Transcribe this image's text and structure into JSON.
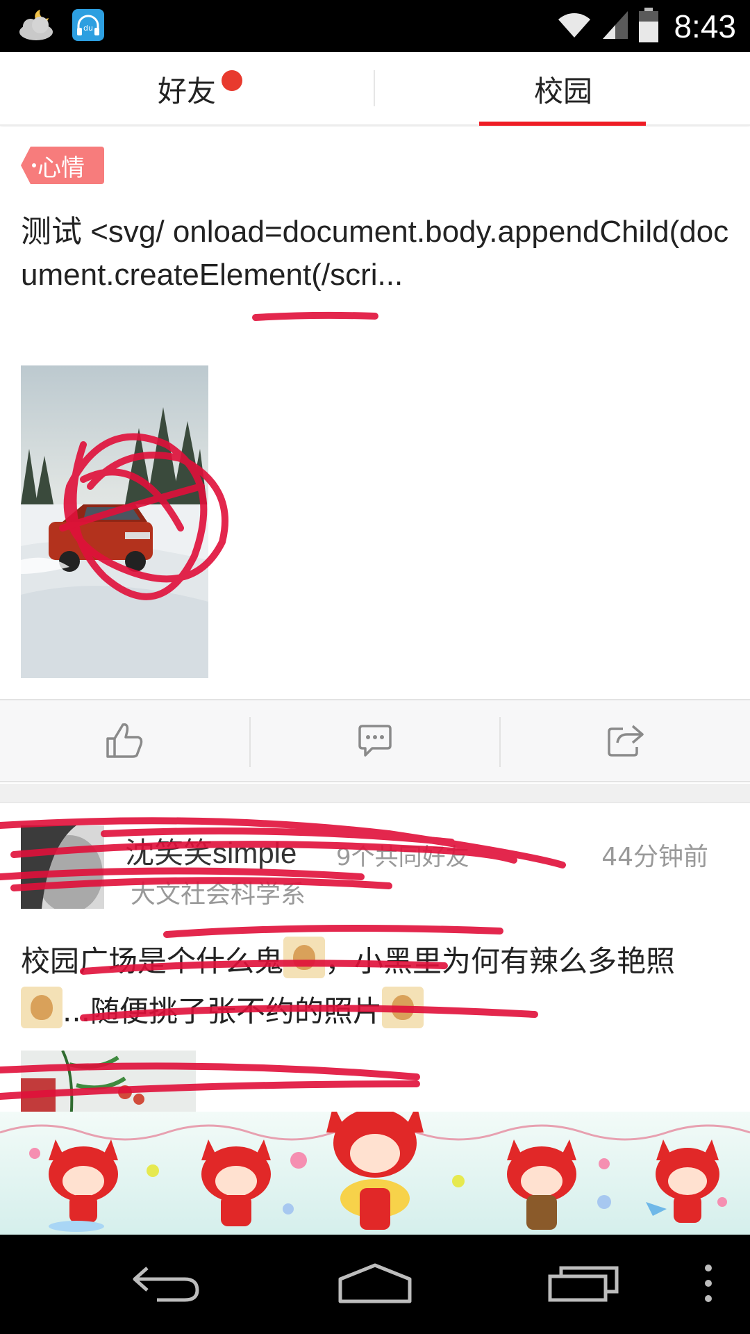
{
  "status_bar": {
    "time": "8:43",
    "icons": [
      "weather-cloud-moon-icon",
      "baidu-music-icon",
      "wifi-icon",
      "signal-icon",
      "battery-icon"
    ]
  },
  "tabs": [
    {
      "label": "好友",
      "has_notification_dot": true,
      "active": false
    },
    {
      "label": "校园",
      "active": true
    }
  ],
  "colors": {
    "accent_red": "#ee1c25",
    "tag_pink": "#f77c7c",
    "scribble_red": "#e0103a",
    "muted_text": "#999999"
  },
  "post1": {
    "tag": "心情",
    "text": "测试 <svg/ onload=document.body.appendChild(document.createElement(/scri...",
    "actions": [
      "like-icon",
      "comment-icon",
      "share-icon"
    ]
  },
  "post2": {
    "author": "沈笑笑simple",
    "mutual_friends": "9个共同好友",
    "time": "44分钟前",
    "department": "大文社会科学系",
    "text_parts": [
      "校园广场是个什么鬼",
      "，小黑里为何有辣么多艳照",
      "...随便挑了张不约的照片"
    ]
  },
  "nav_bar": {
    "buttons": [
      "back-icon",
      "home-icon",
      "recent-apps-icon",
      "menu-icon"
    ]
  }
}
